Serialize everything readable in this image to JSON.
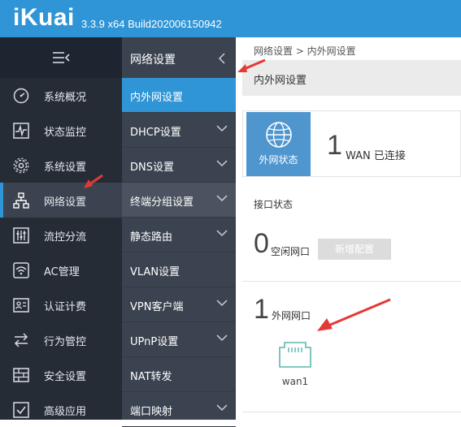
{
  "header": {
    "logo": "iKuai",
    "version": "3.3.9 x64 Build202006150942"
  },
  "sidebar": {
    "items": [
      {
        "label": "系统概况",
        "icon": "dashboard-icon"
      },
      {
        "label": "状态监控",
        "icon": "monitor-icon"
      },
      {
        "label": "系统设置",
        "icon": "gear-icon"
      },
      {
        "label": "网络设置",
        "icon": "network-icon",
        "active": true
      },
      {
        "label": "流控分流",
        "icon": "sliders-icon"
      },
      {
        "label": "AC管理",
        "icon": "wifi-icon"
      },
      {
        "label": "认证计费",
        "icon": "id-card-icon"
      },
      {
        "label": "行为管控",
        "icon": "arrows-icon"
      },
      {
        "label": "安全设置",
        "icon": "firewall-icon"
      },
      {
        "label": "高级应用",
        "icon": "check-box-icon"
      }
    ]
  },
  "subnav": {
    "title": "网络设置",
    "items": [
      {
        "label": "内外网设置",
        "active": true
      },
      {
        "label": "DHCP设置",
        "expandable": true
      },
      {
        "label": "DNS设置",
        "expandable": true
      },
      {
        "label": "终端分组设置",
        "expandable": true
      },
      {
        "label": "静态路由",
        "expandable": true
      },
      {
        "label": "VLAN设置",
        "expandable": false
      },
      {
        "label": "VPN客户端",
        "expandable": true
      },
      {
        "label": "UPnP设置",
        "expandable": true
      },
      {
        "label": "NAT转发",
        "expandable": false
      },
      {
        "label": "端口映射",
        "expandable": true
      }
    ]
  },
  "content": {
    "breadcrumb": "网络设置 > 内外网设置",
    "page_title": "内外网设置",
    "wan_button": "外网状态",
    "wan_count": "1",
    "wan_status": "WAN 已连接",
    "interface_status_label": "接口状态",
    "idle_count": "0",
    "idle_label": "空闲网口",
    "add_button": "新增配置",
    "external_count": "1",
    "external_label": "外网网口",
    "port_name": "wan1"
  },
  "colors": {
    "accent": "#2f95d6",
    "sidebar_bg": "#252c36",
    "subnav_bg": "#3b4350",
    "port_color": "#5bb7ad",
    "arrow": "#e53935"
  }
}
